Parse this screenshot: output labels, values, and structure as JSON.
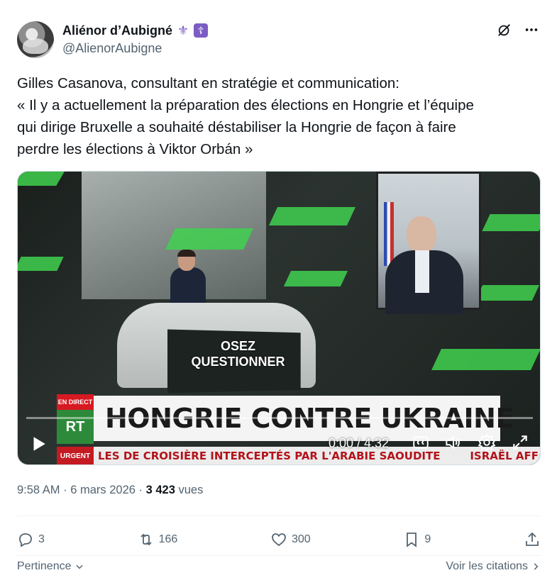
{
  "author": {
    "display_name": "Aliénor d’Aubigné",
    "badge_1": "⚜",
    "badge_2": "☦",
    "handle": "@AlienorAubigne"
  },
  "top_actions": {
    "grok_icon": "grok-icon",
    "more_icon": "more-icon"
  },
  "tweet": {
    "lines": [
      "Gilles Casanova, consultant en stratégie et communication:",
      "« Il y a actuellement la préparation des élections en Hongrie et l’équipe",
      "qui dirige Bruxelle a souhaité déstabiliser la Hongrie de façon à faire",
      "perdre les élections à Viktor Orbán »"
    ]
  },
  "video": {
    "osez_line1": "OSEZ",
    "osez_line2": "QUESTIONNER",
    "direct_tag": "EN DIRECT",
    "channel_logo": "RT",
    "headline": "HONGRIE CONTRE UKRAINE",
    "urgent_tag": "URGENT",
    "ticker": "LES DE CROISIÈRE INTERCEPTÉS PAR L'ARABIE SAOUDITE",
    "ticker_tail": "ISRAËL AFF",
    "time": "0:00 / 4:32",
    "progress": 0.0
  },
  "meta": {
    "time": "9:58 AM",
    "sep1": " · ",
    "date": "6 mars 2026",
    "sep2": " · ",
    "views": "3 423",
    "views_label": " vues"
  },
  "actions": {
    "replies": "3",
    "reposts": "166",
    "likes": "300",
    "bookmarks": "9"
  },
  "footer": {
    "sort_label": "Pertinence",
    "quotes_label": "Voir les citations"
  },
  "colors": {
    "text": "#0f1419",
    "secondary": "#536471",
    "badge": "#7c5cc4",
    "rt_green": "#2d8a3a",
    "alert_red": "#c41a22"
  }
}
